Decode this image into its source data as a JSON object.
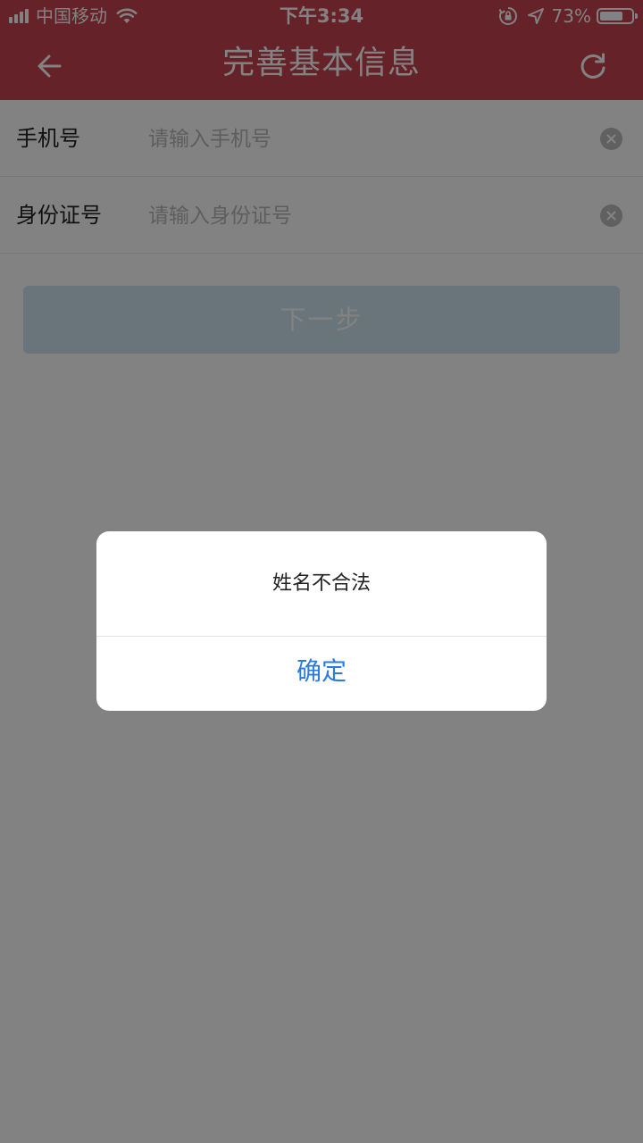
{
  "status_bar": {
    "carrier": "中国移动",
    "time": "下午3:34",
    "battery_percent": "73%",
    "battery_level": 0.73,
    "icons": [
      "signal-icon",
      "wifi-icon",
      "orientation-lock-icon",
      "location-icon",
      "battery-icon"
    ]
  },
  "nav": {
    "title": "完善基本信息",
    "back_icon": "arrow-left-icon",
    "refresh_icon": "refresh-icon"
  },
  "form": {
    "phone": {
      "label": "手机号",
      "placeholder": "请输入手机号",
      "value": ""
    },
    "id_number": {
      "label": "身份证号",
      "placeholder": "请输入身份证号",
      "value": ""
    },
    "clear_icon": "clear-circle-icon",
    "next_label": "下一步"
  },
  "dialog": {
    "message": "姓名不合法",
    "confirm_label": "确定"
  },
  "colors": {
    "header": "#c94452",
    "next_button_disabled": "#cfe6f2",
    "dialog_action": "#2a7bdc",
    "overlay": "rgba(0,0,0,0.49)"
  }
}
